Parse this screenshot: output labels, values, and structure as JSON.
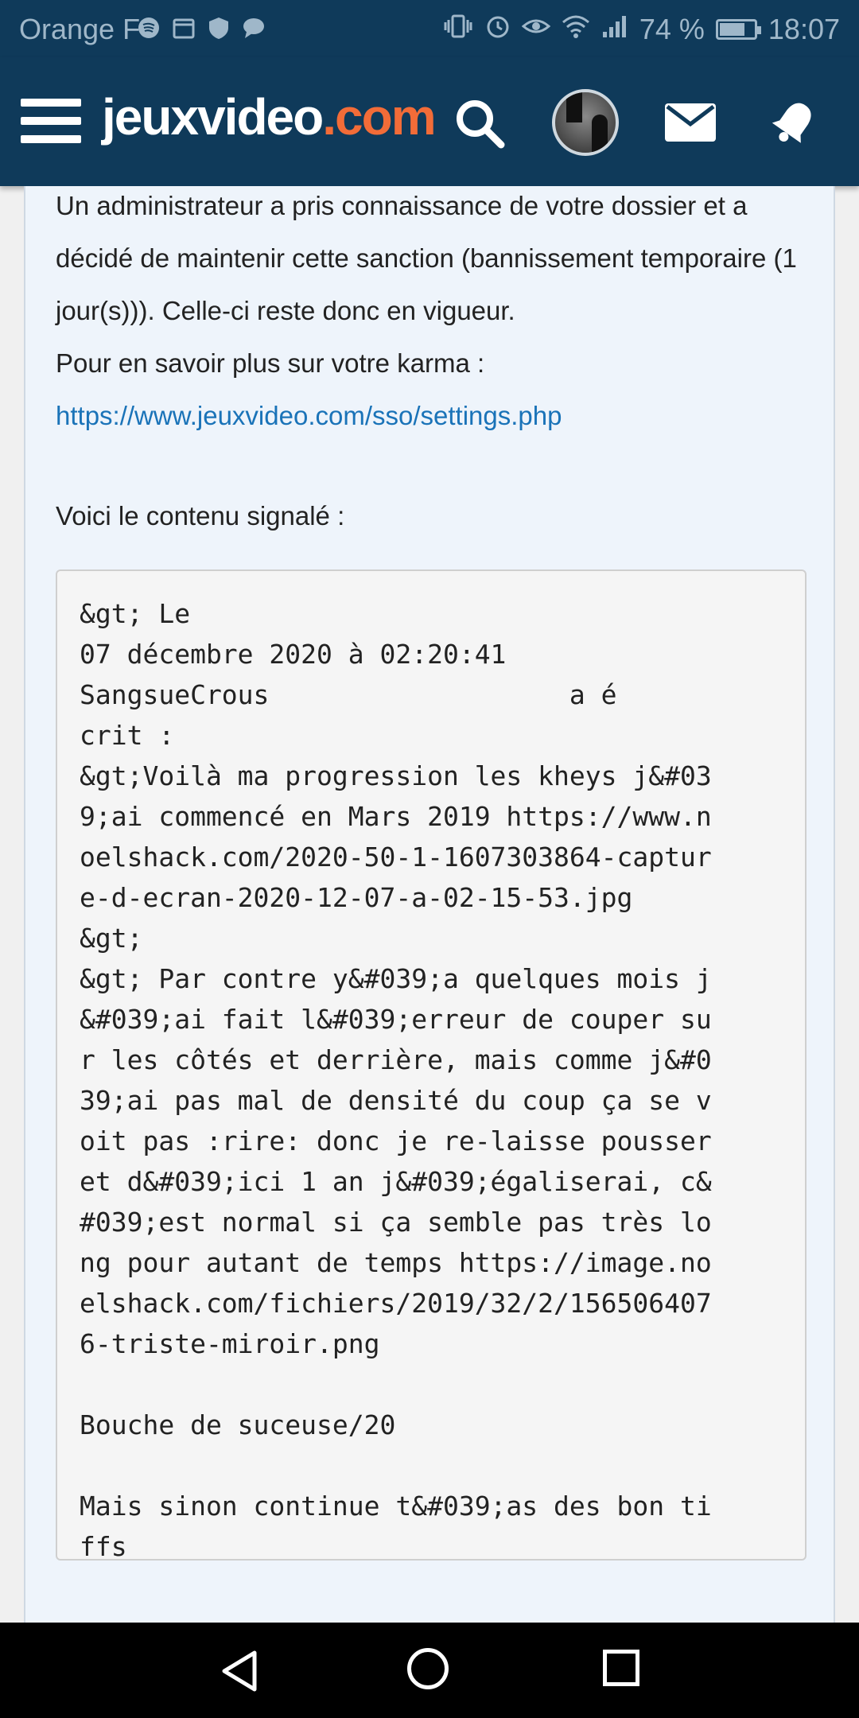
{
  "status_bar": {
    "carrier": "Orange F",
    "battery_text": "74 %",
    "battery_level": 0.74,
    "time": "18:07",
    "icons": [
      "spotify-icon",
      "calendar-icon",
      "shield-icon",
      "message-icon",
      "vibrate-icon",
      "alarm-icon",
      "eye-icon",
      "wifi-icon",
      "signal-icon",
      "battery-icon"
    ]
  },
  "header": {
    "logo_main": "jeuxvideo",
    "logo_tld": ".com",
    "icons": [
      "menu-icon",
      "search-icon",
      "avatar",
      "mail-icon",
      "notification-icon"
    ]
  },
  "message": {
    "paragraph": "Un administrateur a pris connaissance de votre dossier et a décidé de maintenir cette sanction (bannissement temporaire (1 jour(s))). Celle-ci reste donc en vigueur.",
    "karma_text": "Pour en savoir plus sur votre karma :",
    "karma_link": "https://www.jeuxvideo.com/sso/settings.php",
    "reported_label": "Voici le contenu signalé :",
    "reported_content": "&gt; Le\n07 décembre 2020 à 02:20:41\nSangsueCrous                   a é\ncrit :\n&gt;Voilà ma progression les kheys j&#03\n9;ai commencé en Mars 2019 https://www.n\noelshack.com/2020-50-1-1607303864-captur\ne-d-ecran-2020-12-07-a-02-15-53.jpg\n&gt;\n&gt; Par contre y&#039;a quelques mois j\n&#039;ai fait l&#039;erreur de couper su\nr les côtés et derrière, mais comme j&#0\n39;ai pas mal de densité du coup ça se v\noit pas :rire: donc je re-laisse pousser\net d&#039;ici 1 an j&#039;égaliserai, c&\n#039;est normal si ça semble pas très lo\nng pour autant de temps https://image.no\nelshack.com/fichiers/2019/32/2/156506407\n6-triste-miroir.png\n\nBouche de suceuse/20\n\nMais sinon continue t&#039;as des bon ti\nffs"
  },
  "colors": {
    "header_bg": "#0f3a5a",
    "logo_accent": "#f26c38",
    "link": "#1a73b8",
    "content_bg": "#eef4fb"
  },
  "nav_bar": {
    "icons": [
      "back-icon",
      "home-icon",
      "recent-apps-icon"
    ]
  }
}
